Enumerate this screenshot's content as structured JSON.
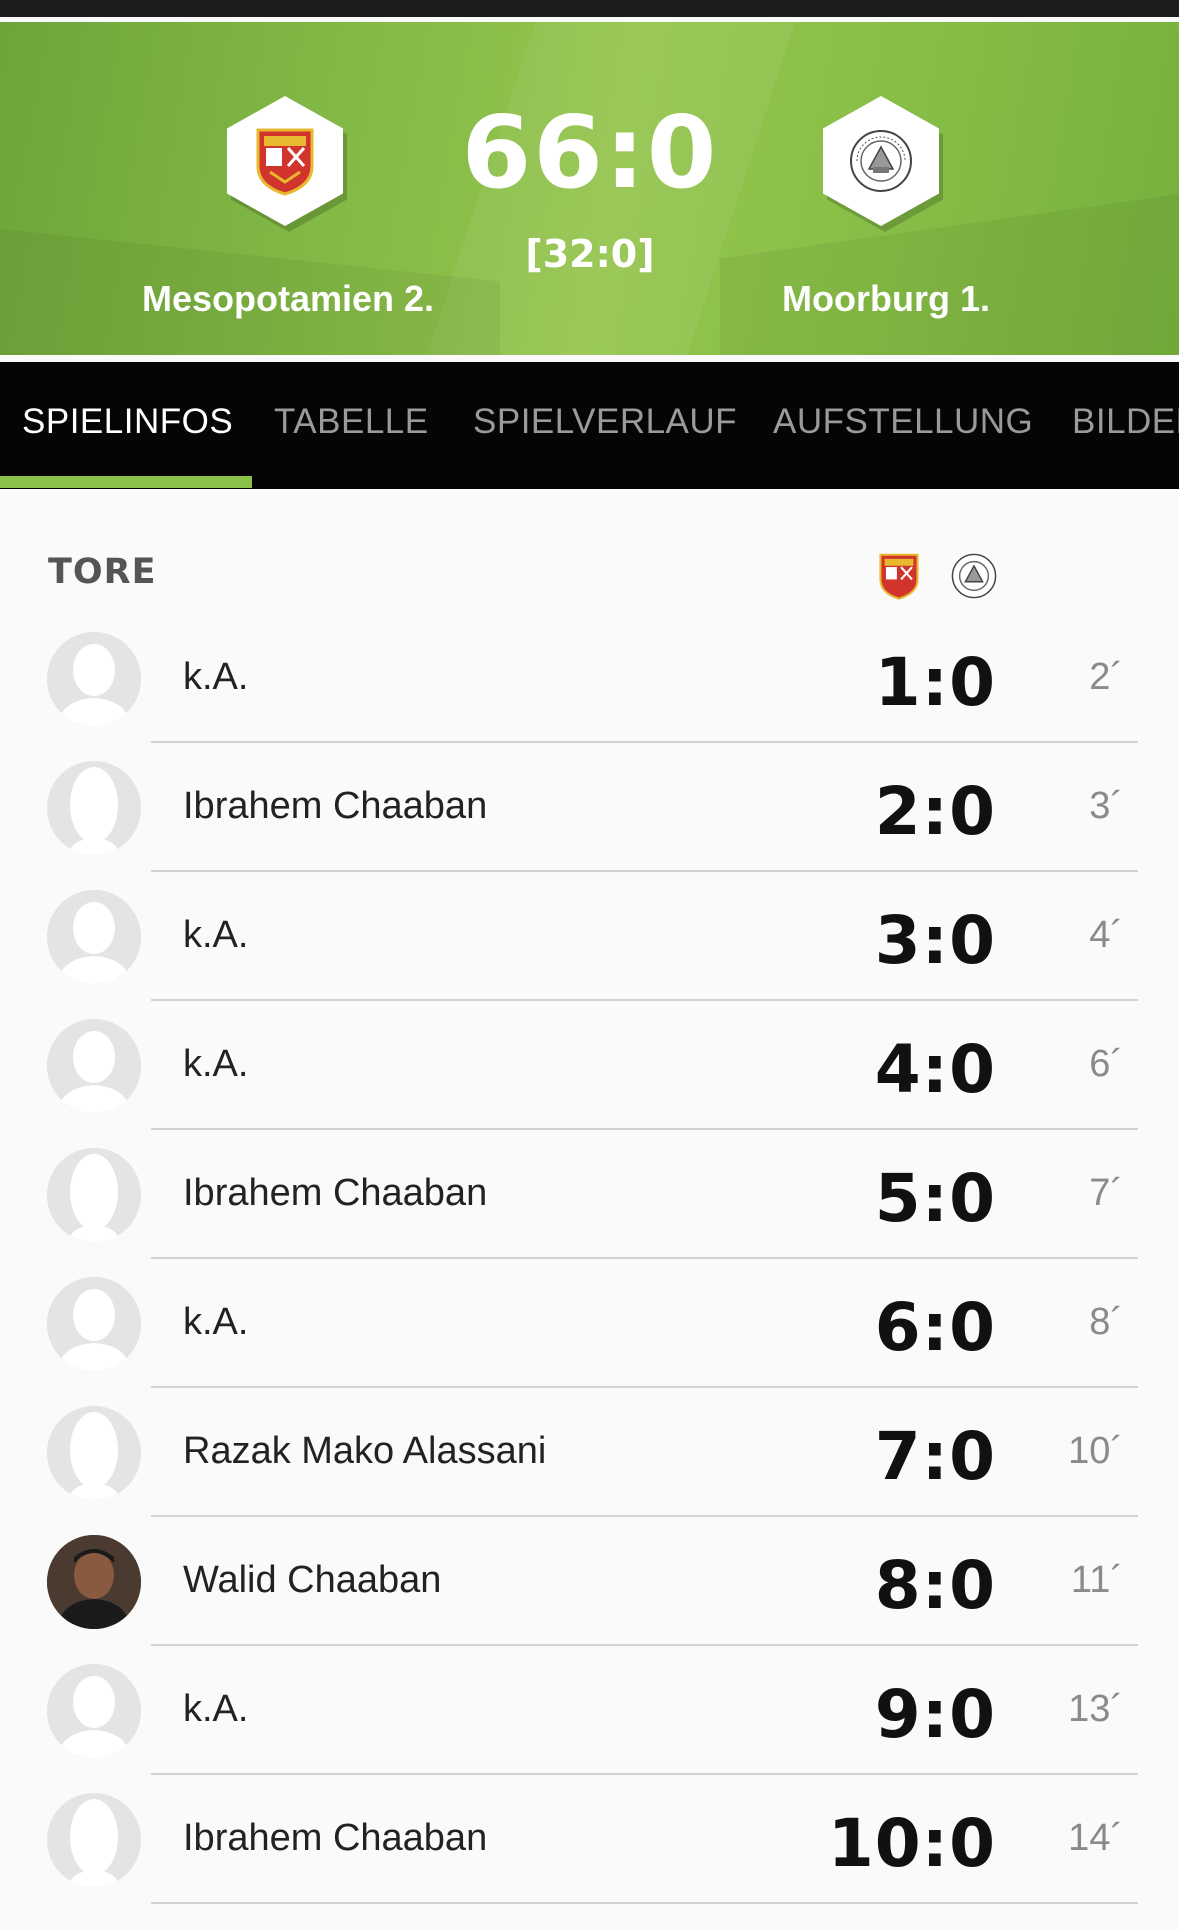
{
  "match": {
    "score": "66:0",
    "halftime": "[32:0]",
    "home_team": "Mesopotamien 2.",
    "away_team": "Moorburg 1."
  },
  "tabs": [
    {
      "label": "SPIELINFOS",
      "active": true
    },
    {
      "label": "TABELLE",
      "active": false
    },
    {
      "label": "SPIELVERLAUF",
      "active": false
    },
    {
      "label": "AUFSTELLUNG",
      "active": false
    },
    {
      "label": "BILDER",
      "active": false
    }
  ],
  "goals_section": {
    "title": "TORE",
    "goals": [
      {
        "player": "k.A.",
        "score": "1:0",
        "minute": "2´",
        "avatar": "placeholder"
      },
      {
        "player": "Ibrahem Chaaban",
        "score": "2:0",
        "minute": "3´",
        "avatar": "placeholder-portrait"
      },
      {
        "player": "k.A.",
        "score": "3:0",
        "minute": "4´",
        "avatar": "placeholder"
      },
      {
        "player": "k.A.",
        "score": "4:0",
        "minute": "6´",
        "avatar": "placeholder"
      },
      {
        "player": "Ibrahem Chaaban",
        "score": "5:0",
        "minute": "7´",
        "avatar": "placeholder-portrait"
      },
      {
        "player": "k.A.",
        "score": "6:0",
        "minute": "8´",
        "avatar": "placeholder"
      },
      {
        "player": "Razak Mako Alassani",
        "score": "7:0",
        "minute": "10´",
        "avatar": "placeholder-portrait"
      },
      {
        "player": "Walid Chaaban",
        "score": "8:0",
        "minute": "11´",
        "avatar": "photo"
      },
      {
        "player": "k.A.",
        "score": "9:0",
        "minute": "13´",
        "avatar": "placeholder"
      },
      {
        "player": "Ibrahem Chaaban",
        "score": "10:0",
        "minute": "14´",
        "avatar": "placeholder-portrait"
      }
    ]
  },
  "colors": {
    "header_green": "#86bd46",
    "tab_bar": "#050505",
    "tab_active_underline": "#8bc34a",
    "home_crest_red": "#d0342c",
    "home_crest_gold": "#e8b82e"
  },
  "icons": {
    "home_crest": "mesopotamien-crest-icon",
    "away_crest": "moorburg-crest-icon",
    "avatar_placeholder": "user-silhouette-icon"
  }
}
